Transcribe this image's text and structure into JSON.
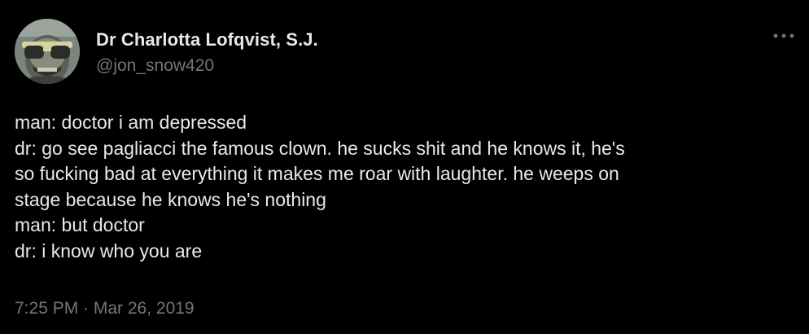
{
  "author": {
    "display_name": "Dr Charlotta Lofqvist, S.J.",
    "handle": "@jon_snow420"
  },
  "tweet": {
    "lines": [
      "man: doctor i am depressed",
      "dr: go see pagliacci the famous clown. he sucks shit and he knows it, he's",
      "so fucking bad at everything it makes me roar with laughter. he weeps on",
      "stage because he knows he's nothing",
      "man: but doctor",
      "dr: i know who you are"
    ],
    "timestamp": "7:25 PM · Mar 26, 2019"
  },
  "icons": {
    "more": "more-horizontal-icon",
    "avatar": "avatar-image"
  },
  "colors": {
    "background": "#000000",
    "primary_text": "#e7e9ea",
    "secondary_text": "#71767b"
  }
}
